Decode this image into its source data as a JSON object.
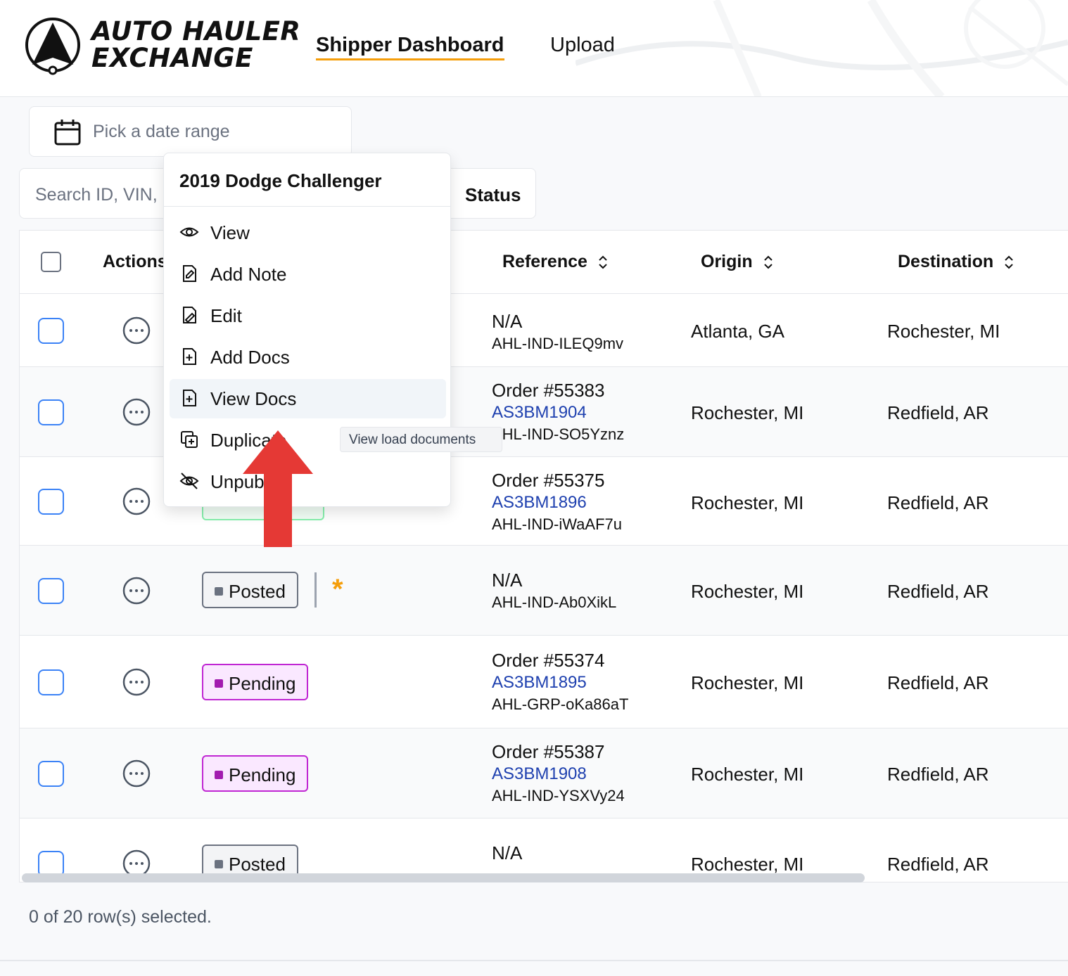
{
  "brand": {
    "line1": "AUTO HAULER",
    "line2": "EXCHANGE"
  },
  "nav": {
    "dashboard": "Shipper Dashboard",
    "upload": "Upload"
  },
  "filters": {
    "date_placeholder": "Pick a date range",
    "search_placeholder": "Search ID, VIN,",
    "status_label": "Status"
  },
  "table": {
    "headers": {
      "actions": "Actions",
      "reference": "Reference",
      "origin": "Origin",
      "destination": "Destination"
    },
    "rows": [
      {
        "status": "",
        "ref_line1": "N/A",
        "vin": "",
        "load_id": "AHL-IND-ILEQ9mv",
        "origin": "Atlanta, GA",
        "destination": "Rochester, MI"
      },
      {
        "status": "",
        "ref_line1": "Order #55383",
        "vin": "AS3BM1904",
        "load_id": "AHL-IND-SO5Yznz",
        "origin": "Rochester, MI",
        "destination": "Redfield, AR"
      },
      {
        "status": "",
        "ref_line1": "Order #55375",
        "vin": "AS3BM1896",
        "load_id": "AHL-IND-iWaAF7u",
        "origin": "Rochester, MI",
        "destination": "Redfield, AR"
      },
      {
        "status": "Posted",
        "ref_line1": "N/A",
        "vin": "",
        "load_id": "AHL-IND-Ab0XikL",
        "origin": "Rochester, MI",
        "destination": "Redfield, AR"
      },
      {
        "status": "Pending",
        "ref_line1": "Order #55374",
        "vin": "AS3BM1895",
        "load_id": "AHL-GRP-oKa86aT",
        "origin": "Rochester, MI",
        "destination": "Redfield, AR"
      },
      {
        "status": "Pending",
        "ref_line1": "Order #55387",
        "vin": "AS3BM1908",
        "load_id": "AHL-IND-YSXVy24",
        "origin": "Rochester, MI",
        "destination": "Redfield, AR"
      },
      {
        "status": "Posted",
        "ref_line1": "N/A",
        "vin": "",
        "load_id": "",
        "origin": "Rochester, MI",
        "destination": "Redfield, AR"
      }
    ],
    "star": "*",
    "selected_count": "0 of 20 row(s) selected."
  },
  "menu": {
    "title": "2019 Dodge Challenger",
    "items": [
      {
        "label": "View",
        "icon": "eye-icon"
      },
      {
        "label": "Add Note",
        "icon": "note-icon"
      },
      {
        "label": "Edit",
        "icon": "edit-file-icon"
      },
      {
        "label": "Add Docs",
        "icon": "add-file-icon"
      },
      {
        "label": "View Docs",
        "icon": "add-file-icon"
      },
      {
        "label": "Duplicate",
        "icon": "duplicate-icon"
      },
      {
        "label": "Unpublish",
        "icon": "eye-off-icon"
      }
    ],
    "tooltip": "View load documents"
  },
  "colors": {
    "accent": "#f59e0b",
    "checkbox": "#3b82f6",
    "vin_link": "#1e40af",
    "arrow": "#e53935"
  }
}
